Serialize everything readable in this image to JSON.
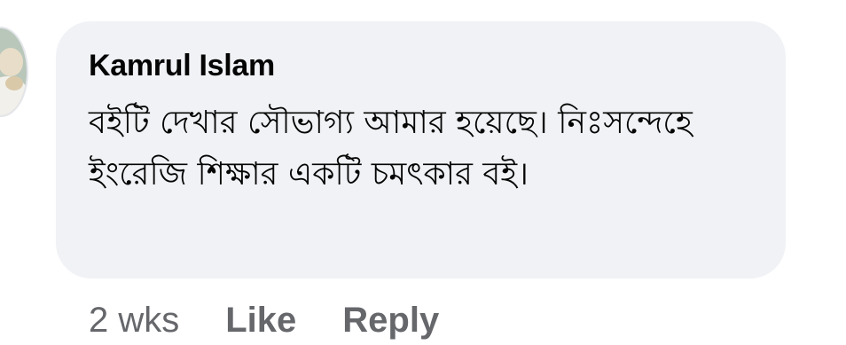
{
  "comment": {
    "author": "Kamrul Islam",
    "text": "বইটি দেখার সৌভাগ্য আমার হয়েছে। নিঃসন্দেহে ইংরেজি শিক্ষার একটি চমৎকার বই।",
    "timestamp": "2 wks",
    "like_label": "Like",
    "reply_label": "Reply"
  },
  "colors": {
    "bubble_background": "#f0f2f5",
    "author_text": "#050505",
    "action_text": "#65676b"
  },
  "icons": {
    "avatar": "user-avatar-photo"
  }
}
